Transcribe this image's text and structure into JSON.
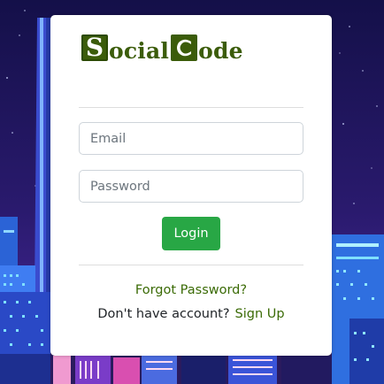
{
  "logo": {
    "first_letter": "S",
    "first_rest": "ocial",
    "second_letter": "C",
    "second_rest": "ode"
  },
  "form": {
    "email_placeholder": "Email",
    "password_placeholder": "Password",
    "login_label": "Login"
  },
  "links": {
    "forgot_password": "Forgot Password?",
    "no_account_text": "Don't have account?",
    "sign_up": "Sign Up"
  },
  "colors": {
    "brand": "#3b5c0a",
    "login_button": "#28a745",
    "link": "#3b6b06"
  }
}
